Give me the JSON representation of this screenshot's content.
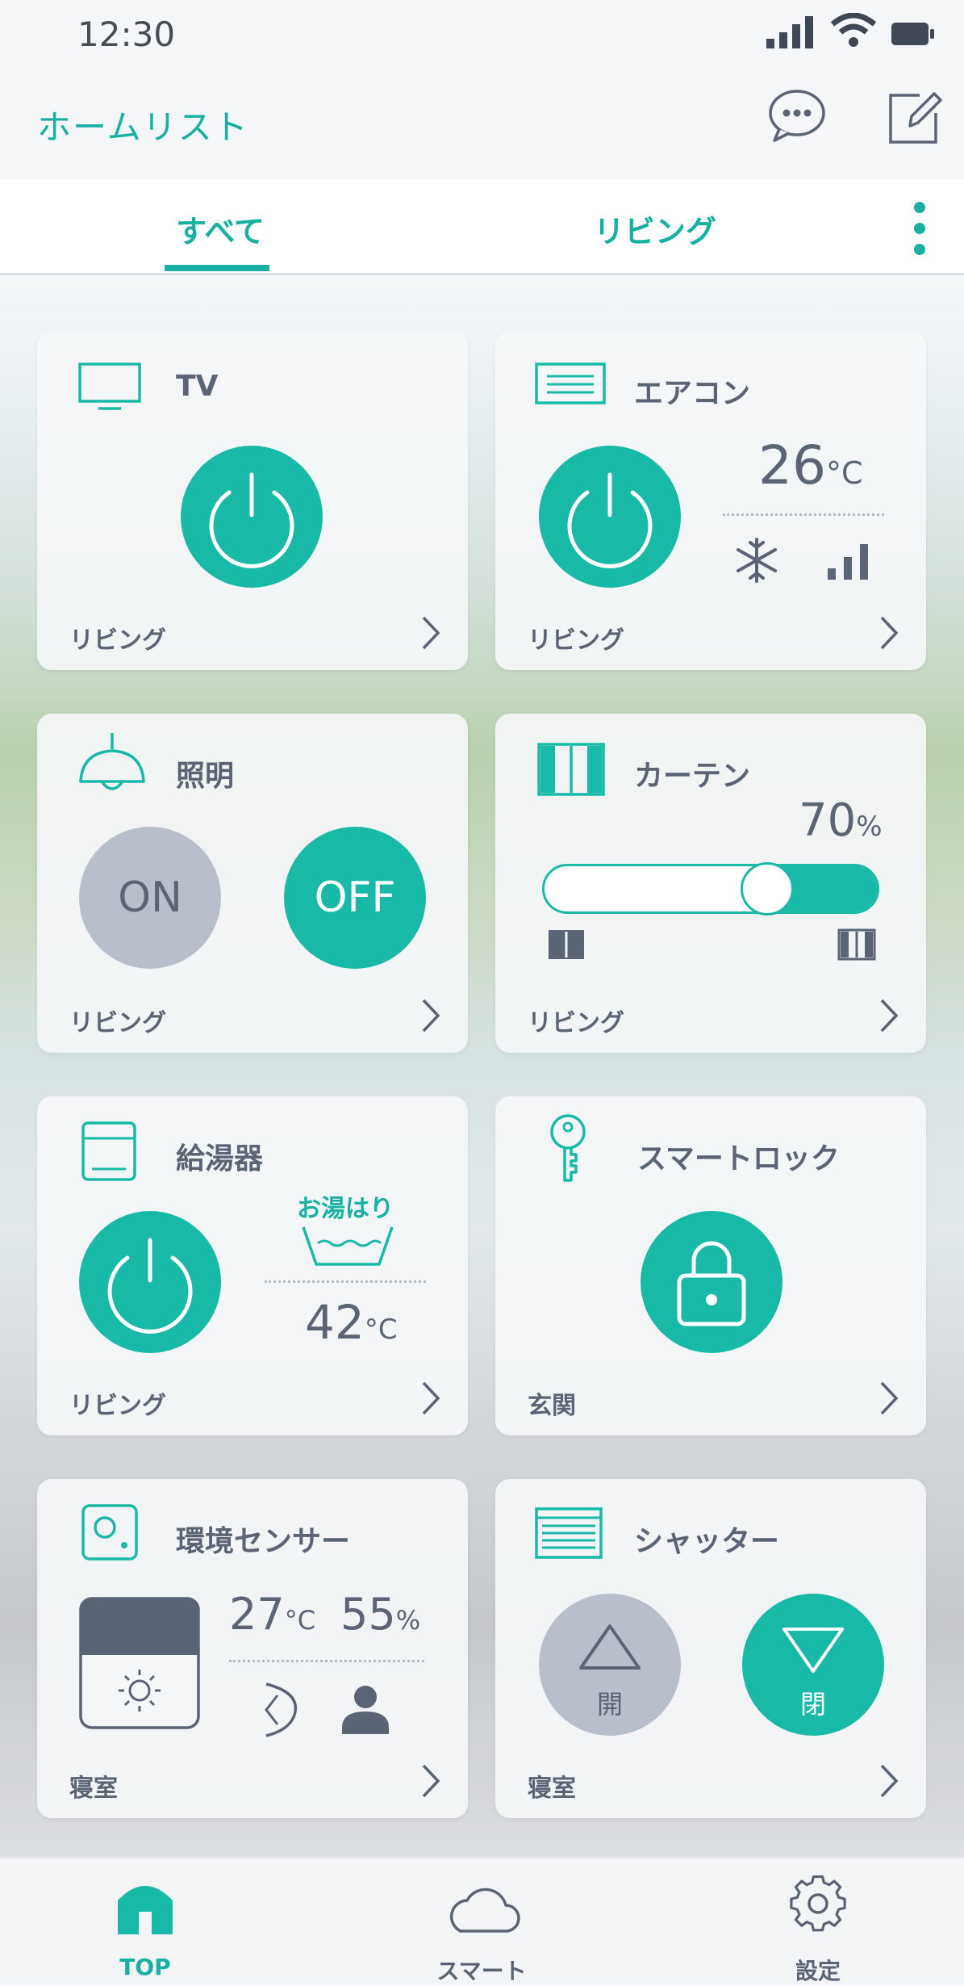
{
  "status": {
    "time": "12:30"
  },
  "header": {
    "title": "ホームリスト",
    "chat_icon": "chat-bubble-icon",
    "edit_icon": "edit-icon"
  },
  "tabs": {
    "items": [
      {
        "label": "すべて",
        "active": true
      },
      {
        "label": "リビング",
        "active": false
      }
    ],
    "more_icon": "more-vertical-icon"
  },
  "devices": {
    "tv": {
      "name": "TV",
      "room": "リビング",
      "icon": "tv-icon"
    },
    "aircon": {
      "name": "エアコン",
      "room": "リビング",
      "temp": "26",
      "temp_unit": "°C",
      "mode_icon": "snowflake-icon",
      "fan_icon": "fan-level-icon"
    },
    "light": {
      "name": "照明",
      "room": "リビング",
      "on_label": "ON",
      "off_label": "OFF"
    },
    "curtain": {
      "name": "カーテン",
      "room": "リビング",
      "percent": "70",
      "percent_unit": "%",
      "level": 0.7
    },
    "water_heater": {
      "name": "給湯器",
      "room": "リビング",
      "fill_label": "お湯はり",
      "temp": "42",
      "temp_unit": "°C"
    },
    "smart_lock": {
      "name": "スマートロック",
      "room": "玄関",
      "icon": "key-icon"
    },
    "env_sensor": {
      "name": "環境センサー",
      "room": "寝室",
      "temp": "27",
      "temp_unit": "°C",
      "humidity": "55",
      "humidity_unit": "%"
    },
    "shutter": {
      "name": "シャッター",
      "room": "寝室",
      "open_label": "開",
      "close_label": "閉"
    }
  },
  "nav": {
    "items": [
      {
        "label": "TOP",
        "active": true
      },
      {
        "label": "スマート",
        "active": false
      },
      {
        "label": "設定",
        "active": false
      }
    ]
  },
  "colors": {
    "accent": "#18b9a6",
    "text": "#5a6474",
    "gray_button": "#b9bfca"
  }
}
